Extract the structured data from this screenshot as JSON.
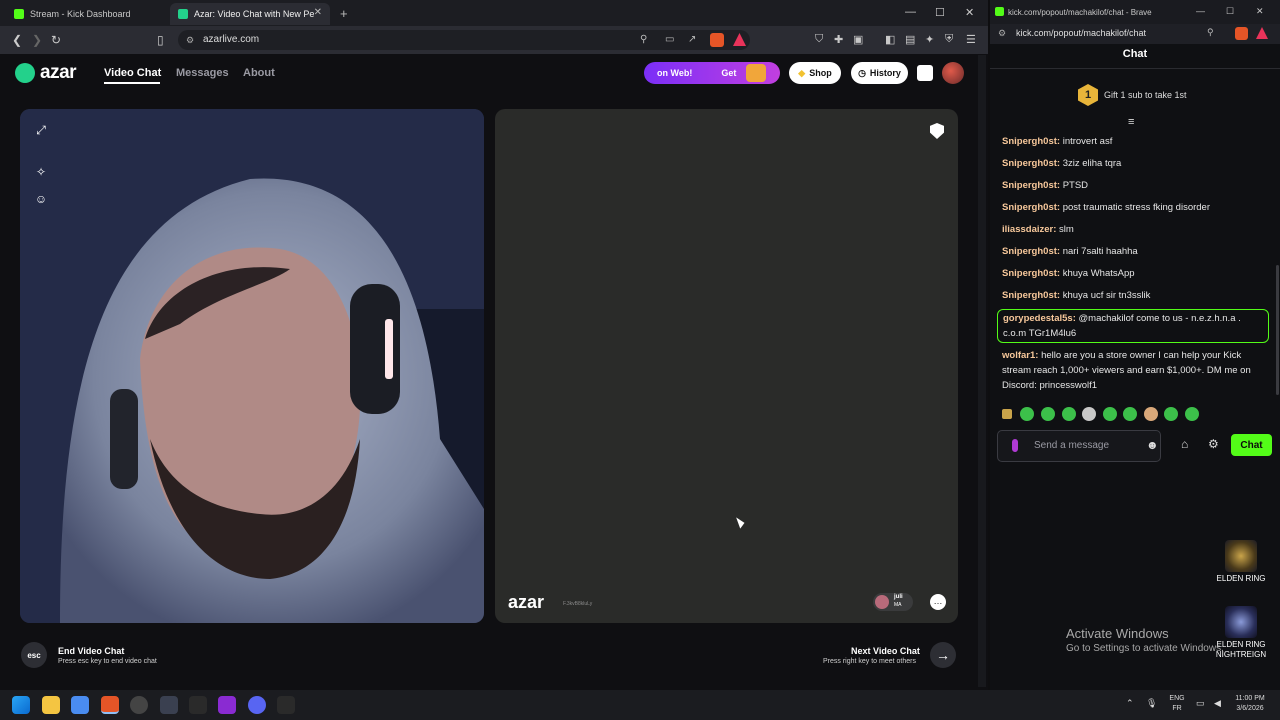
{
  "browser_left": {
    "tabs": [
      {
        "label": "Stream - Kick Dashboard",
        "active": false,
        "favicon_color": "#53fc18"
      },
      {
        "label": "Azar: Video Chat with New Pe",
        "active": true,
        "favicon_color": "#23d18b"
      }
    ],
    "new_tab": "+",
    "url": "azarlive.com"
  },
  "azar": {
    "logo": "azar",
    "nav": [
      {
        "label": "Video Chat",
        "active": true
      },
      {
        "label": "Messages",
        "active": false
      },
      {
        "label": "About",
        "active": false
      }
    ],
    "promo_text": "on Web!",
    "promo_cta": "Get",
    "shop_label": "Shop",
    "history_label": "History",
    "watermark": "azar",
    "watermark_id": "F.3kvB8kluLy",
    "partner_name": "juli",
    "partner_country": "MA",
    "end_key": "esc",
    "end_title": "End Video Chat",
    "end_sub": "Press esc key to end video chat",
    "next_title": "Next Video Chat",
    "next_sub": "Press right key to meet others",
    "colors": {
      "accent": "#23d18b",
      "promo": "#8a2be2"
    }
  },
  "browser_right": {
    "title": "kick.com/popout/machakilof/chat - Brave",
    "url": "kick.com/popout/machakilof/chat"
  },
  "chat": {
    "header": "Chat",
    "gift_count": "1",
    "gift_text": "Gift 1 sub to take 1st",
    "messages": [
      {
        "user": "Snipergh0st:",
        "text": "introvert asf",
        "color": "#f7c89b"
      },
      {
        "user": "Snipergh0st:",
        "text": "3ziz eliha tqra",
        "color": "#f7c89b"
      },
      {
        "user": "Snipergh0st:",
        "text": "PTSD",
        "color": "#f7c89b"
      },
      {
        "user": "Snipergh0st:",
        "text": "post traumatic stress fking disorder",
        "color": "#f7c89b"
      },
      {
        "user": "iliassdaizer:",
        "text": "slm",
        "color": "#f7c89b"
      },
      {
        "user": "Snipergh0st:",
        "text": "nari 7salti haahha",
        "color": "#f7c89b"
      },
      {
        "user": "Snipergh0st:",
        "text": "khuya WhatsApp",
        "color": "#f7c89b"
      },
      {
        "user": "Snipergh0st:",
        "text": "khuya ucf sir tn3sslik",
        "color": "#f7c89b"
      },
      {
        "user": "gorypedestal5s:",
        "text": "@machakilof come to us - n.e.z.h.n.a . c.o.m TGr1M4lu6",
        "color": "#f7c89b"
      },
      {
        "user": "wolfar1:",
        "text": "hello are you a store owner I can help your Kick stream reach 1,000+ viewers and earn $1,000+. DM me on Discord: princesswolf1",
        "color": "#f7c89b"
      }
    ],
    "input_placeholder": "Send a message",
    "send_label": "Chat",
    "accent": "#53fc18"
  },
  "desktop": {
    "icons": [
      {
        "label": "ELDEN RING"
      },
      {
        "label": "ELDEN RING NIGHTREIGN"
      }
    ],
    "activate_title": "Activate Windows",
    "activate_sub": "Go to Settings to activate Windows."
  },
  "taskbar": {
    "lang_top": "ENG",
    "lang_bottom": "FR",
    "time": "11:00 PM",
    "date": "3/6/2026",
    "apps": [
      "windows",
      "file-explorer",
      "store",
      "brave",
      "chrome-dev",
      "steam",
      "g-app",
      "next",
      "discord",
      "g-app-2"
    ]
  }
}
